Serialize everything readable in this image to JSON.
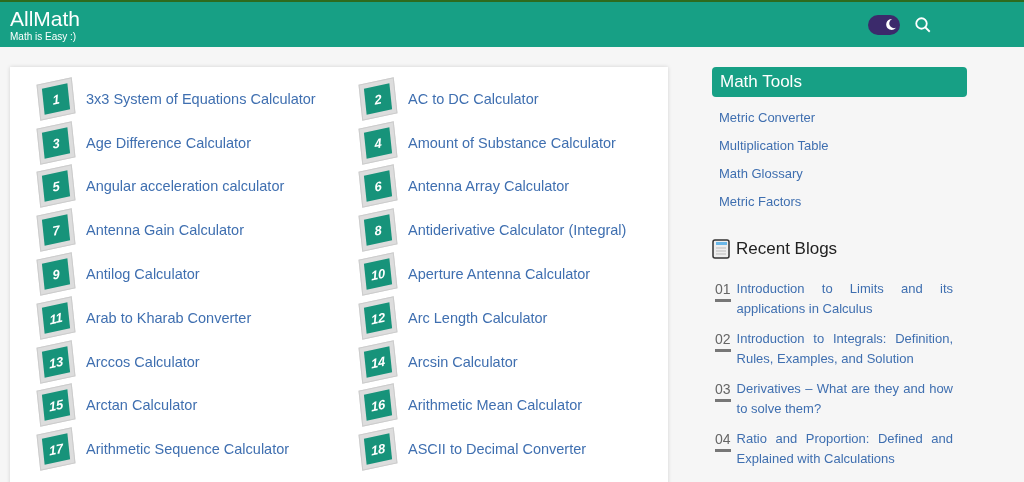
{
  "header": {
    "logo": "AllMath",
    "tagline": "Math is Easy :)",
    "dark_mode": {
      "on": true
    }
  },
  "calculators": [
    {
      "number": "1",
      "label": "3x3 System of Equations Calculator"
    },
    {
      "number": "2",
      "label": "AC to DC Calculator"
    },
    {
      "number": "3",
      "label": "Age Difference Calculator"
    },
    {
      "number": "4",
      "label": "Amount of Substance Calculator"
    },
    {
      "number": "5",
      "label": "Angular acceleration calculator"
    },
    {
      "number": "6",
      "label": "Antenna Array Calculator"
    },
    {
      "number": "7",
      "label": "Antenna Gain Calculator"
    },
    {
      "number": "8",
      "label": "Antiderivative Calculator (Integral)"
    },
    {
      "number": "9",
      "label": "Antilog Calculator"
    },
    {
      "number": "10",
      "label": "Aperture Antenna Calculator"
    },
    {
      "number": "11",
      "label": "Arab to Kharab Converter"
    },
    {
      "number": "12",
      "label": "Arc Length Calculator"
    },
    {
      "number": "13",
      "label": "Arccos Calculator"
    },
    {
      "number": "14",
      "label": "Arcsin Calculator"
    },
    {
      "number": "15",
      "label": "Arctan Calculator"
    },
    {
      "number": "16",
      "label": "Arithmetic Mean Calculator"
    },
    {
      "number": "17",
      "label": "Arithmetic Sequence Calculator"
    },
    {
      "number": "18",
      "label": "ASCII to Decimal Converter"
    }
  ],
  "sidebar": {
    "tools_title": "Math Tools",
    "tools": [
      "Metric Converter",
      "Multiplication Table",
      "Math Glossary",
      "Metric Factors"
    ],
    "blogs_title": "Recent Blogs",
    "blogs": [
      {
        "number": "01",
        "title": "Introduction to Limits and its applications in Calculus"
      },
      {
        "number": "02",
        "title": "Introduction to Integrals: Definition, Rules, Examples, and Solution"
      },
      {
        "number": "03",
        "title": "Derivatives – What are they and how to solve them?"
      },
      {
        "number": "04",
        "title": "Ratio and Proportion: Defined and Explained with Calculations"
      }
    ]
  }
}
